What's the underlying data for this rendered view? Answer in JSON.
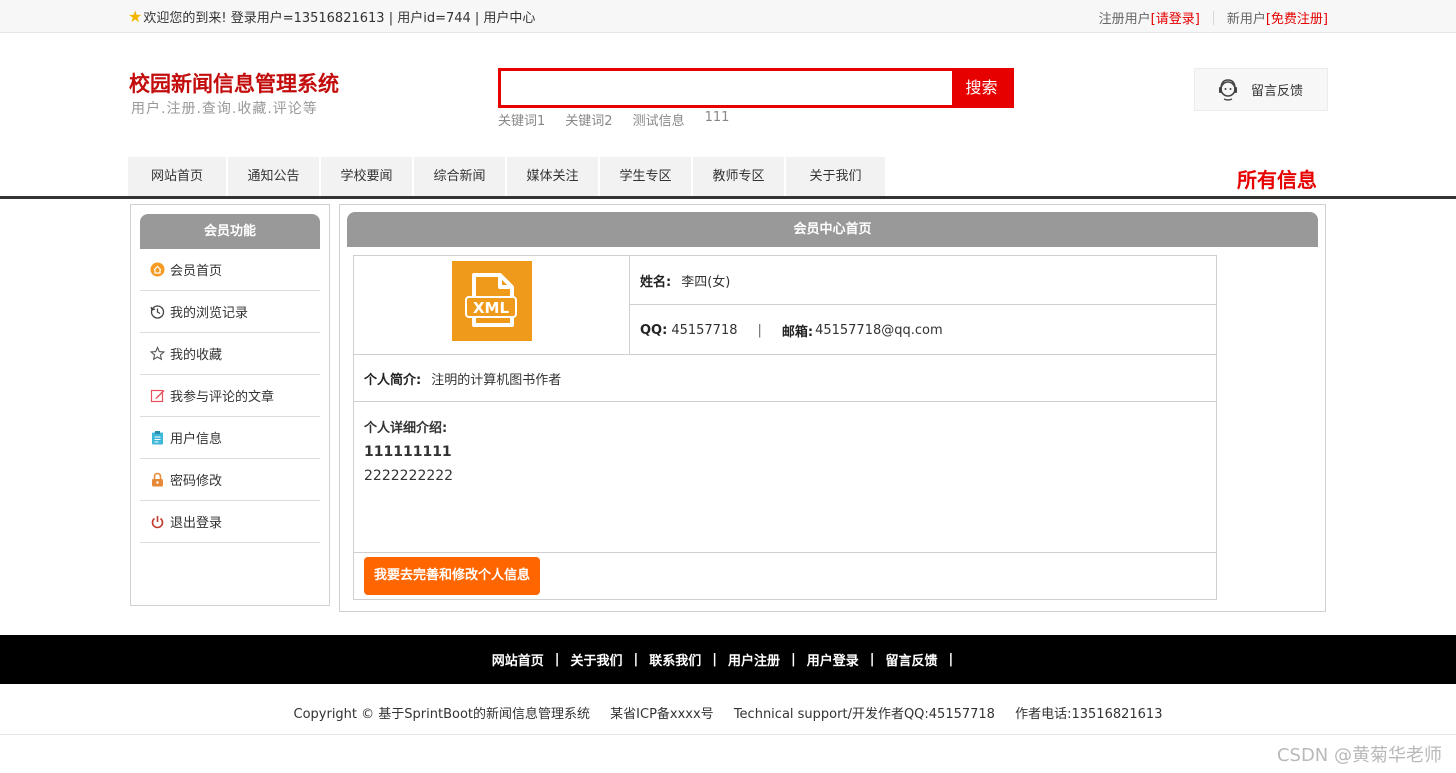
{
  "topbar": {
    "welcome": "欢迎您的到来!  登录用户=13516821613 | 用户id=744 | 用户中心",
    "register_user_label": "注册用户",
    "login_link": "[请登录]",
    "new_user_label": "新用户",
    "register_link": "[免费注册]"
  },
  "header": {
    "site_title": "校园新闻信息管理系统",
    "site_subtitle": "用户.注册.查询.收藏.评论等",
    "search_button": "搜索",
    "search_value": "",
    "hotwords": [
      "关键词1",
      "关键词2",
      "测试信息",
      "111"
    ],
    "feedback_label": "留言反馈"
  },
  "nav": {
    "items": [
      {
        "label": "网站首页",
        "w": 100
      },
      {
        "label": "通知公告",
        "w": 93
      },
      {
        "label": "学校要闻",
        "w": 93
      },
      {
        "label": "综合新闻",
        "w": 93
      },
      {
        "label": "媒体关注",
        "w": 93
      },
      {
        "label": "学生专区",
        "w": 93
      },
      {
        "label": "教师专区",
        "w": 93
      },
      {
        "label": "关于我们",
        "w": 101
      }
    ],
    "all_info": "所有信息"
  },
  "sidebar": {
    "title": "会员功能",
    "items": [
      {
        "label": "会员首页",
        "icon": "home-icon"
      },
      {
        "label": "我的浏览记录",
        "icon": "history-icon"
      },
      {
        "label": "我的收藏",
        "icon": "star-icon"
      },
      {
        "label": "我参与评论的文章",
        "icon": "edit-icon"
      },
      {
        "label": "用户信息",
        "icon": "clipboard-icon"
      },
      {
        "label": "密码修改",
        "icon": "lock-icon"
      },
      {
        "label": "退出登录",
        "icon": "power-icon"
      }
    ]
  },
  "main": {
    "title": "会员中心首页",
    "avatar_icon": "xml-file-icon",
    "name_label": "姓名:",
    "name_value": "李四(女)",
    "qq_label": "QQ:",
    "qq_value": "45157718",
    "divider": "|",
    "email_label": "邮箱:",
    "email_value": "45157718@qq.com",
    "intro_label": "个人简介:",
    "intro_value": "注明的计算机图书作者",
    "detail_label": "个人详细介绍:",
    "detail_line1": "111111111",
    "detail_line2": "2222222222",
    "edit_button": "我要去完善和修改个人信息"
  },
  "footer": {
    "links": [
      "网站首页",
      "关于我们",
      "联系我们",
      "用户注册",
      "用户登录",
      "留言反馈"
    ],
    "separator": "|",
    "copyright": "Copyright © 基于SprintBoot的新闻信息管理系统",
    "icp": "某省ICP备xxxx号",
    "support": "Technical support/开发作者QQ:45157718",
    "phone": "作者电话:13516821613"
  },
  "watermark": "CSDN @黄菊华老师",
  "colors": {
    "accent": "#e60000",
    "title": "#c30d0d",
    "button": "#ff6600",
    "panel_head": "#999999"
  }
}
